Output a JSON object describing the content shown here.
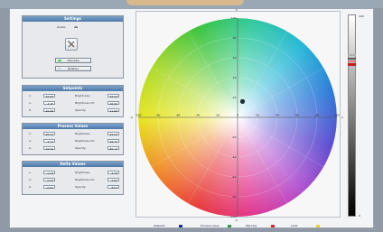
{
  "settings": {
    "title": "Settings",
    "grade_label": "Grade:",
    "grade_value": "ab",
    "absolute_label": "Absolute",
    "relative_label": "Relative",
    "absolute_led": "#3bd13b",
    "relative_led": "#c9cdd2"
  },
  "setpoints": {
    "title": "Setpoints",
    "rows": [
      {
        "l_key": "L:",
        "l_val": "46.90",
        "r_key": "Brightness:",
        "r_val": "46.90"
      },
      {
        "l_key": "a:",
        "l_val": "-3.15",
        "r_key": "Brightness UV:",
        "r_val": "46.90"
      },
      {
        "l_key": "b:",
        "l_val": "16.40",
        "r_key": "Opacity:",
        "r_val": "71.60"
      }
    ]
  },
  "process_values": {
    "title": "Process Values",
    "rows": [
      {
        "l_key": "L:",
        "l_val": "45.47",
        "r_key": "Brightness:",
        "r_val": "49.23"
      },
      {
        "l_key": "a:",
        "l_val": "-3.11",
        "r_key": "Brightness UV:",
        "r_val": "49.71"
      },
      {
        "l_key": "b:",
        "l_val": "15.52",
        "r_key": "Opacity:",
        "r_val": "80.17"
      }
    ]
  },
  "delta_values": {
    "title": "Delta Values",
    "rows": [
      {
        "l_key": "L:",
        "l_val": "-1.43",
        "r_key": "Brightness:",
        "r_val": "2.33"
      },
      {
        "l_key": "a:",
        "l_val": "0.04",
        "r_key": "Brightness UV:",
        "r_val": "2.81"
      },
      {
        "l_key": "b:",
        "l_val": "-0.87",
        "r_key": "Opacity:",
        "r_val": "8.57"
      }
    ]
  },
  "color_wheel": {
    "top_label": "b",
    "bottom_label": "-b",
    "left_label": "-a",
    "right_label": "a",
    "x_ticks": [
      "-100",
      "-80",
      "-60",
      "-40",
      "-20",
      "0",
      "20",
      "40",
      "60",
      "80",
      "100"
    ],
    "y_ticks": [
      "100",
      "80",
      "60",
      "40",
      "20",
      "-20",
      "-40",
      "-60",
      "-80",
      "-100"
    ],
    "marker_a": 5,
    "marker_b": 16
  },
  "lightness_scale": {
    "top": "100",
    "bottom": "0",
    "colors": [
      "#b0b0b0",
      "#5a5a5a",
      "#e07474",
      "#c41d1d"
    ]
  },
  "legend": [
    {
      "label": "Setpoint",
      "color": "#1c2fa0"
    },
    {
      "label": "Process value",
      "color": "#2f9a4a"
    },
    {
      "label": "Warning",
      "color": "#d42a2a"
    },
    {
      "label": "Limit",
      "color": "#f1d22a"
    }
  ]
}
